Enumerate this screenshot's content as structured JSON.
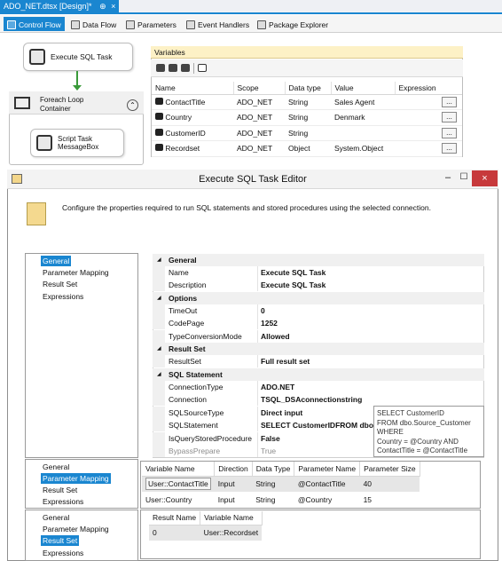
{
  "document_tab": {
    "title": "ADO_NET.dtsx [Design]*",
    "pin": "⊕",
    "close": "×"
  },
  "designer_tabs": [
    {
      "label": "Control Flow",
      "icon": "control-flow-icon"
    },
    {
      "label": "Data Flow",
      "icon": "data-flow-icon"
    },
    {
      "label": "Parameters",
      "icon": "parameters-icon"
    },
    {
      "label": "Event Handlers",
      "icon": "event-handlers-icon"
    },
    {
      "label": "Package Explorer",
      "icon": "package-explorer-icon"
    }
  ],
  "design_surface": {
    "execute_sql_task": "Execute SQL Task",
    "foreach_loop": "Foreach Loop Container",
    "script_task": "Script Task MessageBox",
    "collapse_glyph": "⌃"
  },
  "variables_panel": {
    "title": "Variables",
    "columns": [
      "Name",
      "Scope",
      "Data type",
      "Value",
      "Expression"
    ],
    "rows": [
      {
        "name": "ContactTitle",
        "scope": "ADO_NET",
        "type": "String",
        "value": "Sales Agent",
        "expression": ""
      },
      {
        "name": "Country",
        "scope": "ADO_NET",
        "type": "String",
        "value": "Denmark",
        "expression": ""
      },
      {
        "name": "CustomerID",
        "scope": "ADO_NET",
        "type": "String",
        "value": "",
        "expression": ""
      },
      {
        "name": "Recordset",
        "scope": "ADO_NET",
        "type": "Object",
        "value": "System.Object",
        "expression": ""
      }
    ],
    "ellipsis": "..."
  },
  "editor": {
    "title": "Execute SQL Task Editor",
    "minimize": "–",
    "maximize": "☐",
    "close": "×",
    "description": "Configure the properties required to run SQL statements and stored procedures using the selected connection.",
    "nav_items": [
      "General",
      "Parameter Mapping",
      "Result Set",
      "Expressions"
    ],
    "property_grid": {
      "general": {
        "category": "General",
        "name_label": "Name",
        "name_value": "Execute SQL Task",
        "desc_label": "Description",
        "desc_value": "Execute SQL Task"
      },
      "options": {
        "category": "Options",
        "timeout_label": "TimeOut",
        "timeout_value": "0",
        "codepage_label": "CodePage",
        "codepage_value": "1252",
        "tcm_label": "TypeConversionMode",
        "tcm_value": "Allowed"
      },
      "result_set": {
        "category": "Result Set",
        "label": "ResultSet",
        "value": "Full result set"
      },
      "sql_statement": {
        "category": "SQL Statement",
        "conntype_label": "ConnectionType",
        "conntype_value": "ADO.NET",
        "conn_label": "Connection",
        "conn_value": "TSQL_DSAconnectionstring",
        "source_label": "SQLSourceType",
        "source_value": "Direct input",
        "stmt_label": "SQLStatement",
        "stmt_value": "SELECT CustomerIDFROM dbo",
        "isqsp_label": "IsQueryStoredProcedure",
        "isqsp_value": "False",
        "bypass_label": "BypassPrepare",
        "bypass_value": "True"
      },
      "collapse_glyph": "◢"
    },
    "sql_tooltip": "SELECT CustomerID\nFROM dbo.Source_Customer\nWHERE\nCountry = @Country AND\nContactTitle = @ContactTitle",
    "parameter_mapping": {
      "columns": [
        "Variable Name",
        "Direction",
        "Data Type",
        "Parameter Name",
        "Parameter Size"
      ],
      "rows": [
        {
          "variable": "User::ContactTitle",
          "direction": "Input",
          "type": "String",
          "param": "@ContactTitle",
          "size": "40"
        },
        {
          "variable": "User::Country",
          "direction": "Input",
          "type": "String",
          "param": "@Country",
          "size": "15"
        }
      ]
    },
    "result_set": {
      "columns": [
        "Result Name",
        "Variable Name"
      ],
      "rows": [
        {
          "result": "0",
          "variable": "User::Recordset"
        }
      ]
    }
  },
  "colors": {
    "accent": "#1a86d0",
    "variables_header": "#fdf1c6",
    "close_red": "#c7393b",
    "connector_green": "#3a9a3a"
  }
}
